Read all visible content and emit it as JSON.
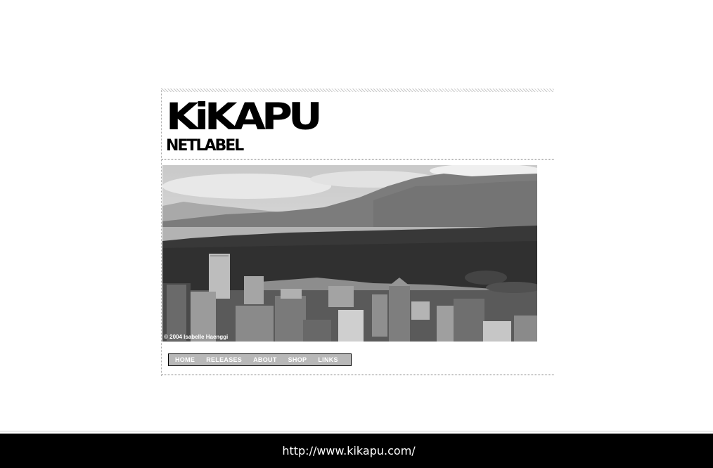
{
  "logo": {
    "title": "KiKAPU",
    "subtitle": "NETLABEL"
  },
  "photo": {
    "credit": "© 2004 Isabelle Haenggi"
  },
  "nav": {
    "items": [
      {
        "label": "HOME"
      },
      {
        "label": "RELEASES"
      },
      {
        "label": "ABOUT"
      },
      {
        "label": "SHOP"
      },
      {
        "label": "LINKS"
      }
    ]
  },
  "status_bar": {
    "url": "http://www.kikapu.com/"
  },
  "colors": {
    "page_background": "#ffffff",
    "nav_background": "#b8b8b8",
    "status_bar_background": "#000000"
  }
}
